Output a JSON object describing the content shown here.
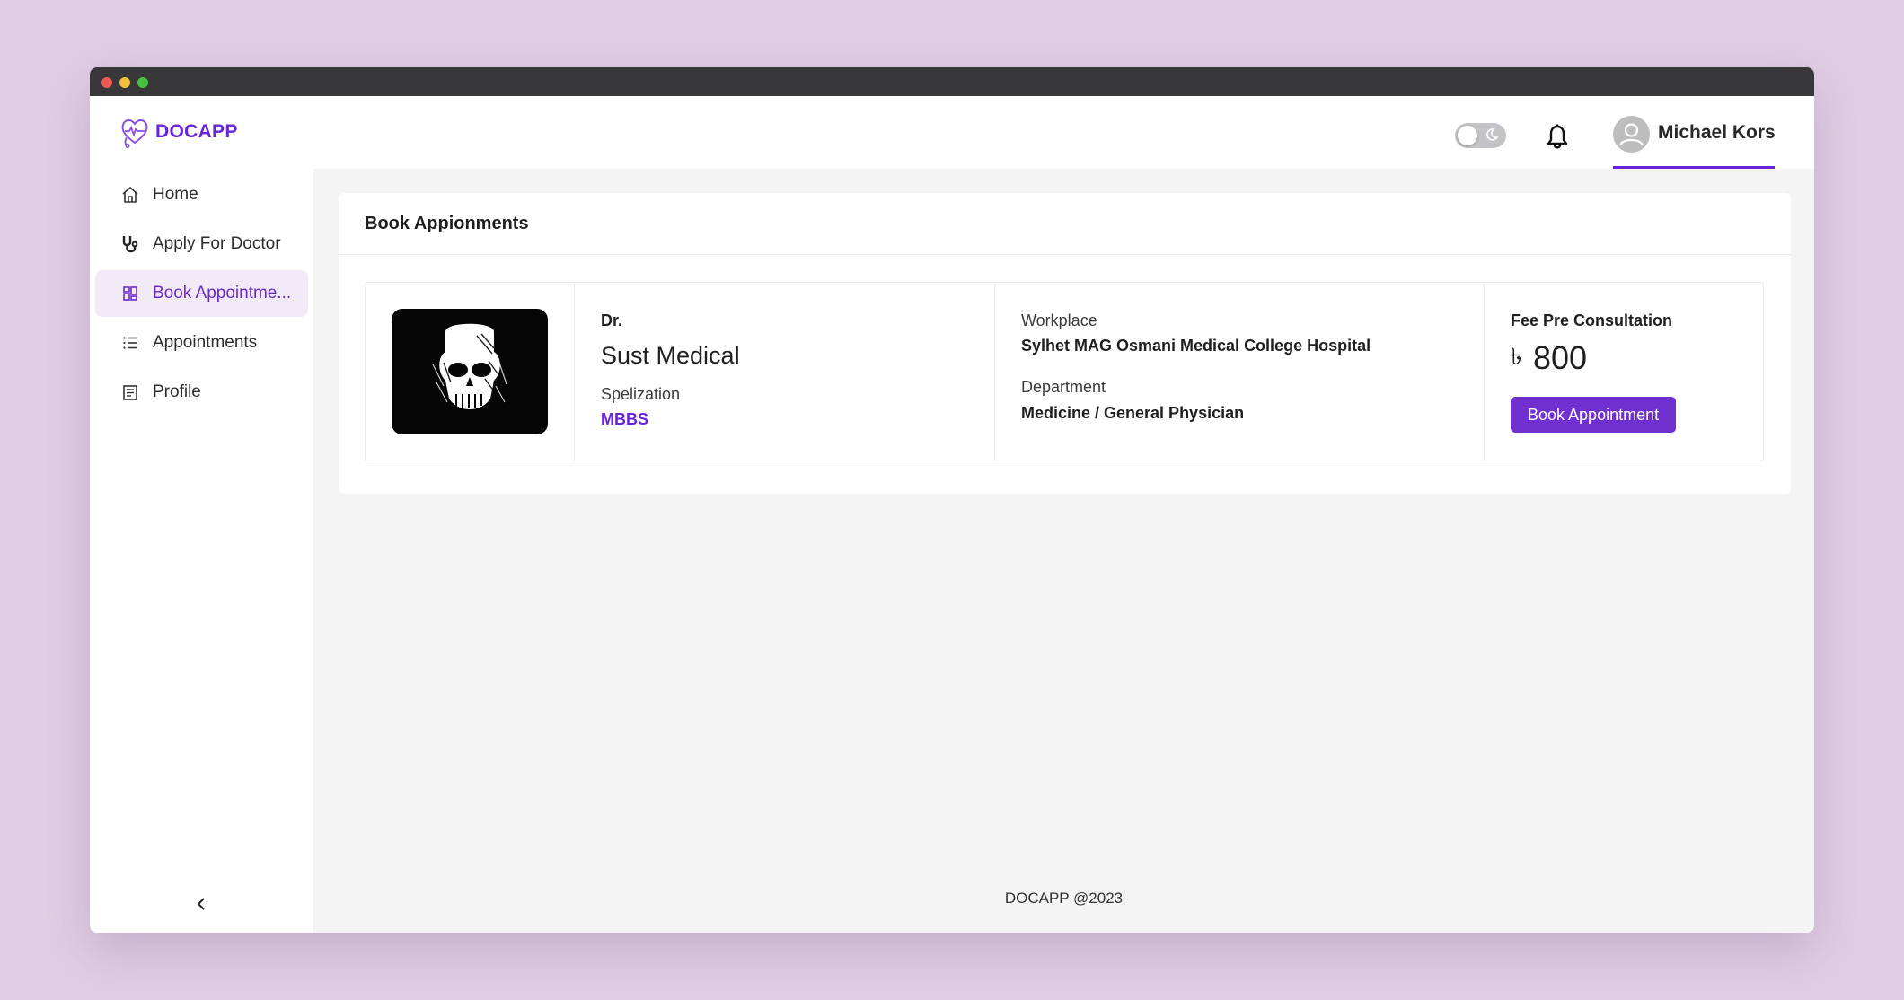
{
  "app": {
    "name": "DOCAPP"
  },
  "header": {
    "user_name": "Michael Kors"
  },
  "sidebar": {
    "items": [
      {
        "label": "Home",
        "icon": "home-icon",
        "active": false
      },
      {
        "label": "Apply For Doctor",
        "icon": "stethoscope-icon",
        "active": false
      },
      {
        "label": "Book Appointme...",
        "icon": "grid-icon",
        "active": true
      },
      {
        "label": "Appointments",
        "icon": "list-icon",
        "active": false
      },
      {
        "label": "Profile",
        "icon": "profile-icon",
        "active": false
      }
    ]
  },
  "main": {
    "title": "Book Appionments",
    "doctor": {
      "prefix": "Dr.",
      "name": "Sust Medical",
      "specialization_label": "Spelization",
      "specialization": "MBBS",
      "workplace_label": "Workplace",
      "workplace": "Sylhet MAG Osmani Medical College Hospital",
      "department_label": "Department",
      "department": "Medicine / General Physician",
      "fee_label": "Fee Pre Consultation",
      "currency_symbol": "৳",
      "fee": "800",
      "book_button": "Book Appointment"
    }
  },
  "footer": {
    "text": "DOCAPP @2023"
  },
  "colors": {
    "accent": "#6a24d8",
    "button": "#7030cf",
    "background": "#e0cde5",
    "active_nav_bg": "#f3eaf8"
  }
}
